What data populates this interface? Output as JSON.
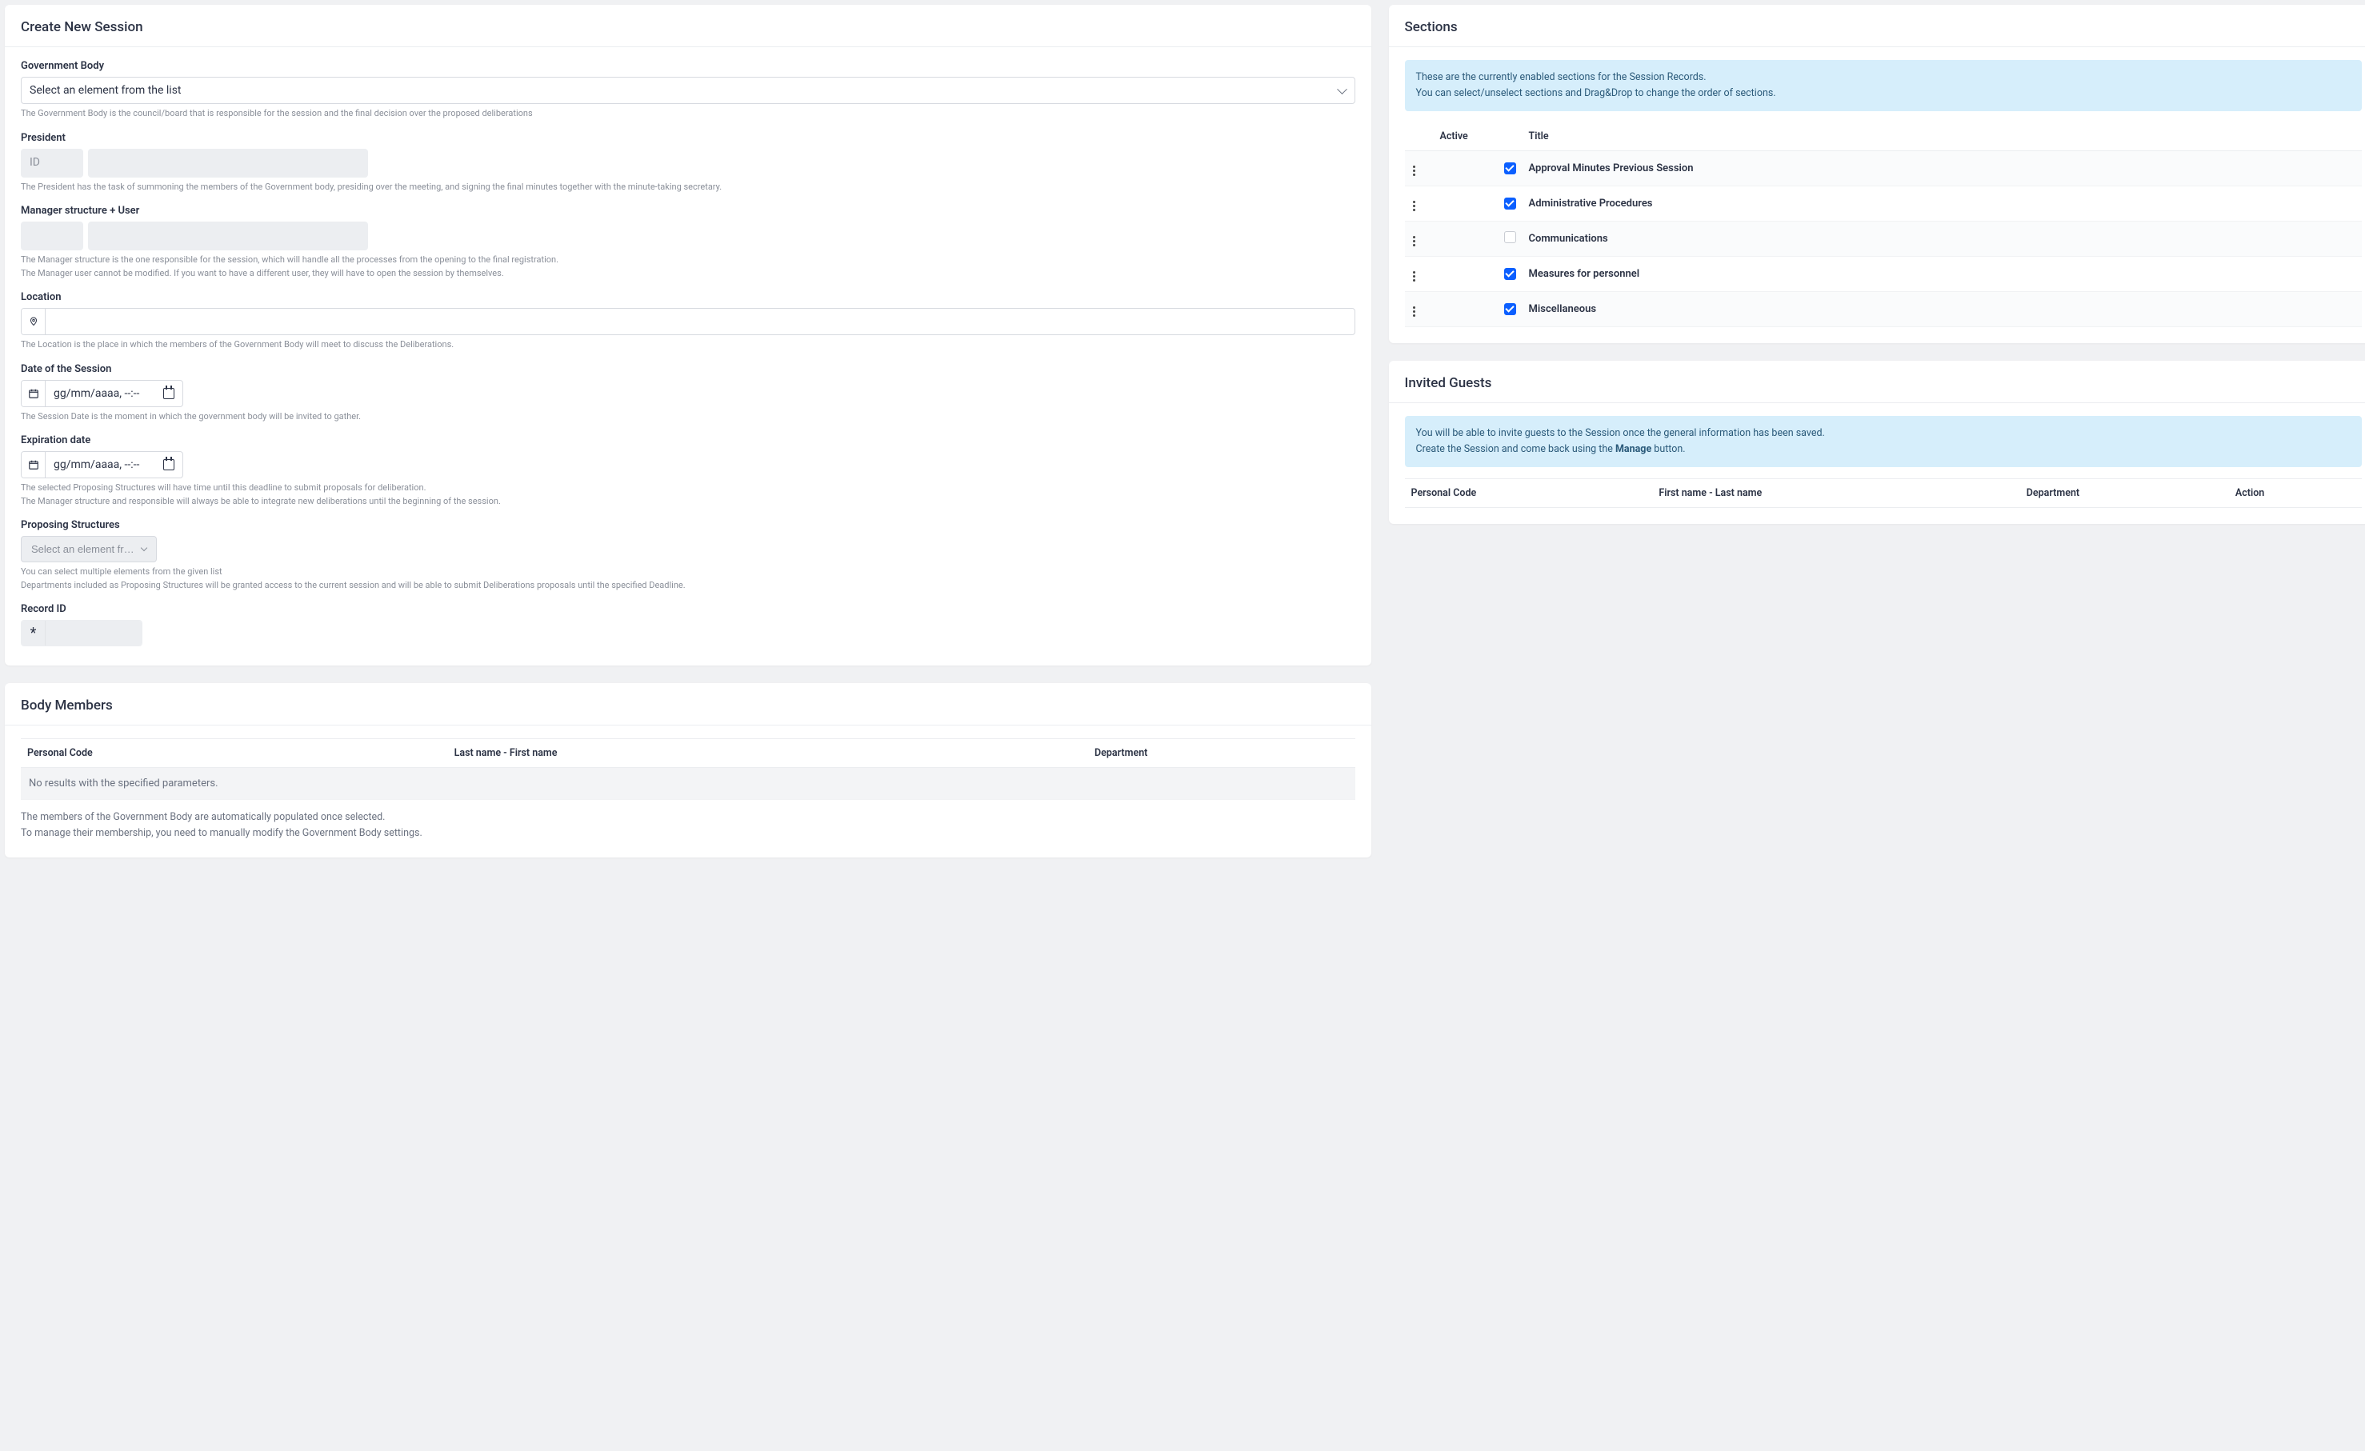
{
  "create": {
    "title": "Create New Session",
    "gov_body": {
      "label": "Government Body",
      "placeholder": "Select an element from the list",
      "help": "The Government Body is the council/board that is responsible for the session and the final decision over the proposed deliberations"
    },
    "president": {
      "label": "President",
      "id_placeholder": "ID",
      "help": "The President has the task of summoning the members of the Government body, presiding over the meeting, and signing the final minutes together with the minute-taking secretary."
    },
    "manager": {
      "label": "Manager structure + User",
      "help_line1": "The Manager structure is the one responsible for the session, which will handle all the processes from the opening to the final registration.",
      "help_line2": "The Manager user cannot be modified. If you want to have a different user, they will have to open the session by themselves."
    },
    "location": {
      "label": "Location",
      "help": "The Location is the place in which the members of the Government Body will meet to discuss the Deliberations."
    },
    "date": {
      "label": "Date of the Session",
      "placeholder": "gg/mm/aaaa, --:--",
      "help": "The Session Date is the moment in which the government body will be invited to gather."
    },
    "expiration": {
      "label": "Expiration date",
      "placeholder": "gg/mm/aaaa, --:--",
      "help_line1": "The selected Proposing Structures will have time until this deadline to submit proposals for deliberation.",
      "help_line2": "The Manager structure and responsible will always be able to integrate new deliberations until the beginning of the session."
    },
    "proposing": {
      "label": "Proposing Structures",
      "button": "Select an element from the list",
      "help_line1": "You can select multiple elements from the given list",
      "help_line2": "Departments included as Proposing Structures will be granted access to the current session and will be able to submit Deliberations proposals until the specified Deadline."
    },
    "record_id": {
      "label": "Record ID",
      "addon": "*"
    }
  },
  "sections": {
    "title": "Sections",
    "info_line1": "These are the currently enabled sections for the Session Records.",
    "info_line2": "You can select/unselect sections and Drag&Drop to change the order of sections.",
    "columns": {
      "active": "Active",
      "title": "Title"
    },
    "rows": [
      {
        "active": true,
        "title": "Approval Minutes Previous Session"
      },
      {
        "active": true,
        "title": "Administrative Procedures"
      },
      {
        "active": false,
        "title": "Communications"
      },
      {
        "active": true,
        "title": "Measures for personnel"
      },
      {
        "active": true,
        "title": "Miscellaneous"
      }
    ]
  },
  "body_members": {
    "title": "Body Members",
    "columns": {
      "code": "Personal Code",
      "name": "Last name - First name",
      "dept": "Department"
    },
    "no_results": "No results with the specified parameters.",
    "help_line1": "The members of the Government Body are automatically populated once selected.",
    "help_line2": "To manage their membership, you need to manually modify the Government Body settings."
  },
  "guests": {
    "title": "Invited Guests",
    "info_line1": "You will be able to invite guests to the Session once the general information has been saved.",
    "info_prefix": "Create the Session and come back using the ",
    "info_bold": "Manage",
    "info_suffix": " button.",
    "columns": {
      "code": "Personal Code",
      "name": "First name - Last name",
      "dept": "Department",
      "action": "Action"
    }
  }
}
